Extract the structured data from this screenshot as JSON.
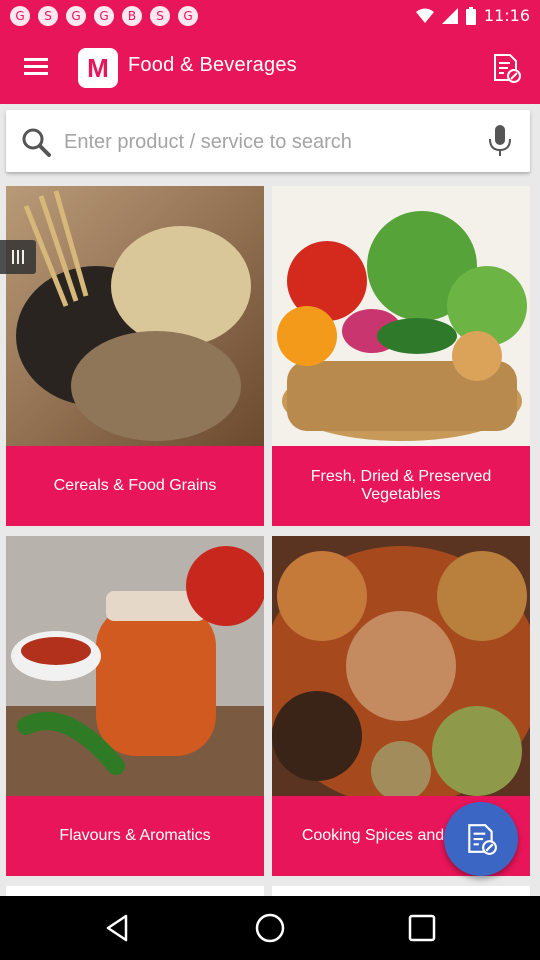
{
  "status": {
    "time": "11:16",
    "notification_icons": [
      "G",
      "S",
      "G",
      "G",
      "B",
      "S",
      "G"
    ]
  },
  "appbar": {
    "logo_letter": "M",
    "title": "Food & Beverages",
    "menu_icon": "overflow-menu-icon",
    "action_icon": "document-edit-icon"
  },
  "search": {
    "placeholder": "Enter product / service to search",
    "value": "",
    "icon": "search-icon",
    "voice_icon": "microphone-icon"
  },
  "categories": [
    {
      "label": "Cereals & Food Grains",
      "image": "grains-photo"
    },
    {
      "label": "Fresh, Dried & Preserved Vegetables",
      "image": "vegetables-basket-photo"
    },
    {
      "label": "Flavours & Aromatics",
      "image": "sauce-jar-photo"
    },
    {
      "label": "Cooking Spices and Masala",
      "image": "spices-platter-photo"
    }
  ],
  "colors": {
    "brand": "#e8155a",
    "fab": "#3b66c4",
    "navbar": "#000000"
  }
}
